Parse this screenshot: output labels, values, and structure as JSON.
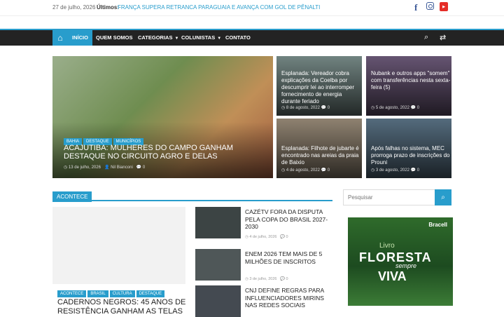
{
  "topbar": {
    "date": "27 de julho, 2026",
    "latest_label": "Últimos:",
    "latest_text": "FRANÇA SUPERA RETRANCA PARAGUAIA E AVANÇA COM GOL DE PÊNALTI"
  },
  "social": [
    "facebook-icon",
    "instagram-icon",
    "youtube-icon"
  ],
  "nav": [
    "INÍCIO",
    "QUEM SOMOS",
    "CATEGORIAS",
    "COLUNISTAS",
    "CONTATO"
  ],
  "hero": {
    "tags": [
      "BAHIA",
      "DESTAQUE",
      "MUNICÍPIOS"
    ],
    "title": "ACAJUTIBA: MULHERES DO CAMPO GANHAM DESTAQUE NO CIRCUITO AGRO E DELAS",
    "date": "13 de julho, 2026",
    "author": "Nil Bianconi",
    "comments": "0"
  },
  "cards": [
    {
      "title": "Esplanada: Vereador cobra explicações da Coelba por descumprir lei ao interromper fornecimento de energia durante feriado",
      "date": "8 de agosto, 2022",
      "comments": "0"
    },
    {
      "title": "Nubank e outros apps \"somem\" com transferências nesta sexta-feira (5)",
      "date": "5 de agosto, 2022",
      "comments": "0"
    },
    {
      "title": "Esplanada: Filhote de jubarte é encontrado nas areias da praia de Baixio",
      "date": "4 de agosto, 2022",
      "comments": "0"
    },
    {
      "title": "Após falhas no sistema, MEC prorroga prazo de inscrições do Prouni",
      "date": "3 de agosto, 2022",
      "comments": "0"
    }
  ],
  "section": {
    "title": "ACONTECE"
  },
  "featured": {
    "tags": [
      "ACONTECE",
      "BRASIL",
      "CULTURA",
      "DESTAQUE"
    ],
    "title": "CADERNOS NEGROS: 45 ANOS DE RESISTÊNCIA GANHAM AS TELAS"
  },
  "side_list": [
    {
      "title": "CAZÉTV FORA DA DISPUTA PELA COPA DO BRASIL 2027-2030",
      "date": "4 de julho, 2026",
      "comments": "0"
    },
    {
      "title": "ENEM 2026 TEM MAIS DE 5 MILHÕES DE INSCRITOS",
      "date": "3 de julho, 2026",
      "comments": "0"
    },
    {
      "title": "CNJ DEFINE REGRAS PARA INFLUENCIADORES MIRINS NAS REDES SOCIAIS",
      "date": "",
      "comments": ""
    }
  ],
  "search": {
    "placeholder": "Pesquisar"
  },
  "ad": {
    "brand": "Bracell",
    "line1": "Livro",
    "line2": "FLORESTA",
    "line3": "sempre",
    "line4": "VIVA"
  }
}
